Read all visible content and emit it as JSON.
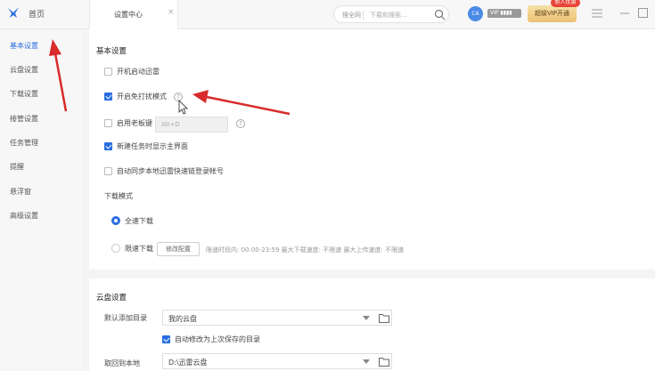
{
  "app": {
    "home_label": "首页"
  },
  "tab": {
    "label": "设置中心",
    "close": "×"
  },
  "search": {
    "scope": "搜全网",
    "placeholder": "下载和搜索..."
  },
  "account": {
    "avatar_text": "CA",
    "vip_badge": "VIP ▮▮▮▮",
    "vip_button": "超级VIP开通",
    "promo_tag": "新人优惠"
  },
  "sidebar": {
    "items": [
      {
        "label": "基本设置"
      },
      {
        "label": "云盘设置"
      },
      {
        "label": "下载设置"
      },
      {
        "label": "接管设置"
      },
      {
        "label": "任务管理"
      },
      {
        "label": "提醒"
      },
      {
        "label": "悬浮窗"
      },
      {
        "label": "高级设置"
      }
    ]
  },
  "basic": {
    "title": "基本设置",
    "options": [
      {
        "label": "开机启动迅雷",
        "checked": false
      },
      {
        "label": "开启免打扰模式",
        "checked": true
      },
      {
        "label": "启用老板键",
        "checked": false
      },
      {
        "label": "新建任务时显示主界面",
        "checked": true
      },
      {
        "label": "自动同步本地迅雷快速链登录帐号",
        "checked": false
      }
    ],
    "hotkey_value": "Alt+D",
    "help_glyph": "?",
    "download_mode": {
      "title": "下载模式",
      "options": [
        {
          "label": "全速下载",
          "selected": true
        },
        {
          "label": "限速下载",
          "selected": false
        }
      ],
      "modify_button": "修改配置",
      "note": "限速时段内: 00:00-23:59  最大下载速度: 不限速  最大上传速度: 不限速"
    }
  },
  "cloud": {
    "title": "云盘设置",
    "default_dir_label": "默认添加目录",
    "default_dir_value": "我的云盘",
    "auto_change_label": "自动修改为上次保存的目录",
    "auto_change_checked": true,
    "save_local_label": "取回到本地",
    "save_local_value": "D:\\迅雷云盘"
  },
  "colors": {
    "accent": "#2a6ee0",
    "annotation": "#d92b2b",
    "vip_gold": "#ebc072"
  },
  "icons": [
    "logo-icon",
    "search-icon",
    "menu-icon",
    "minimize-icon",
    "maximize-icon",
    "folder-icon",
    "help-icon",
    "cursor-icon",
    "arrow-annotation"
  ]
}
